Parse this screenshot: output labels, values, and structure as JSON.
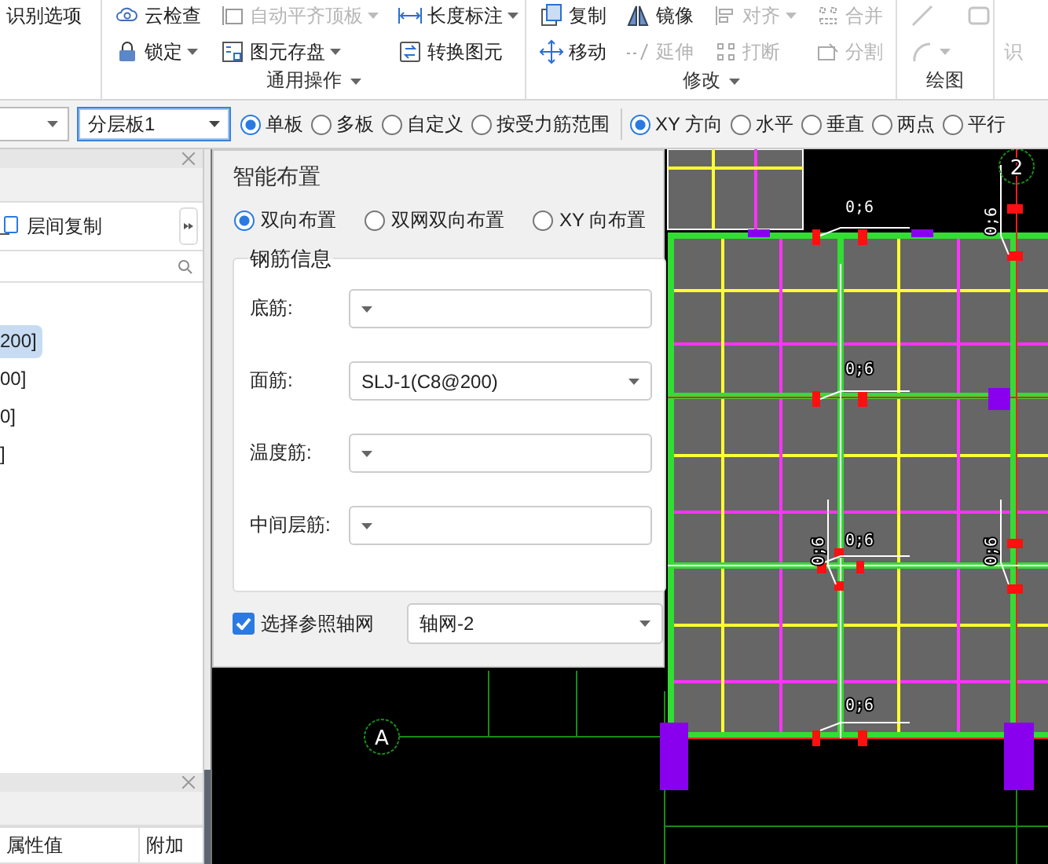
{
  "ribbon": {
    "leading_item": {
      "label": "识别选项"
    },
    "groups": [
      {
        "label": "通用操作",
        "dropdown": true,
        "items": [
          {
            "label": "云检查",
            "disabled": false,
            "dropdown": false
          },
          {
            "label": "自动平齐顶板",
            "disabled": true,
            "dropdown": true
          },
          {
            "label": "长度标注",
            "disabled": false,
            "dropdown": true
          },
          {
            "label": "锁定",
            "disabled": false,
            "dropdown": true
          },
          {
            "label": "图元存盘",
            "disabled": false,
            "dropdown": true
          },
          {
            "label": "转换图元",
            "disabled": false,
            "dropdown": false
          }
        ]
      },
      {
        "label": "修改",
        "dropdown": true,
        "items": [
          {
            "label": "复制",
            "disabled": false,
            "dropdown": false
          },
          {
            "label": "镜像",
            "disabled": false,
            "dropdown": false
          },
          {
            "label": "对齐",
            "disabled": true,
            "dropdown": true
          },
          {
            "label": "合并",
            "disabled": true,
            "dropdown": false
          },
          {
            "label": "移动",
            "disabled": false,
            "dropdown": false
          },
          {
            "label": "延伸",
            "disabled": true,
            "dropdown": false
          },
          {
            "label": "打断",
            "disabled": true,
            "dropdown": false
          },
          {
            "label": "分割",
            "disabled": true,
            "dropdown": false
          }
        ]
      },
      {
        "label": "绘图",
        "dropdown": false,
        "items": [
          {
            "kind": "icon",
            "disabled": true,
            "dropdown": false
          },
          {
            "kind": "icon",
            "disabled": true,
            "dropdown": false
          },
          {
            "kind": "icon",
            "disabled": true,
            "dropdown": true
          }
        ]
      }
    ],
    "trailing_item": {
      "label": "识"
    }
  },
  "options_bar": {
    "dropdown": {
      "value": "分层板1",
      "focused": true
    },
    "scope_options": [
      {
        "label": "单板",
        "selected": true
      },
      {
        "label": "多板",
        "selected": false
      },
      {
        "label": "自定义",
        "selected": false
      },
      {
        "label": "按受力筋范围",
        "selected": false
      }
    ],
    "direction_options": [
      {
        "label": "XY 方向",
        "selected": true
      },
      {
        "label": "水平",
        "selected": false
      },
      {
        "label": "垂直",
        "selected": false
      },
      {
        "label": "两点",
        "selected": false
      },
      {
        "label": "平行",
        "selected": false
      }
    ]
  },
  "layers_panel": {
    "copy_button": {
      "label": "层间复制"
    },
    "tree": [
      {
        "label": "200]",
        "selected": true
      },
      {
        "label": "00]",
        "selected": false
      },
      {
        "label": "0]",
        "selected": false
      },
      {
        "label": "]",
        "selected": false
      }
    ]
  },
  "properties_panel": {
    "columns": [
      "属性值",
      "附加"
    ]
  },
  "dialog": {
    "title": "智能布置",
    "layout_options": [
      {
        "label": "双向布置",
        "selected": true
      },
      {
        "label": "双网双向布置",
        "selected": false
      },
      {
        "label": "XY 向布置",
        "selected": false
      }
    ],
    "rebar_group": {
      "title": "钢筋信息",
      "fields": [
        {
          "label": "底筋:"
        },
        {
          "label": "面筋:",
          "value": "SLJ-1(C8@200)"
        },
        {
          "label": "温度筋:"
        },
        {
          "label": "中间层筋:"
        }
      ]
    },
    "reference_axis": {
      "label": "选择参照轴网",
      "checked": true,
      "value": "轴网-2"
    }
  },
  "canvas": {
    "axis_labels": [
      "2",
      "A"
    ],
    "dimension_labels": [
      "0;6",
      "0;6",
      "0;6",
      "0;6",
      "0;6",
      "0;6",
      "0;6"
    ]
  }
}
